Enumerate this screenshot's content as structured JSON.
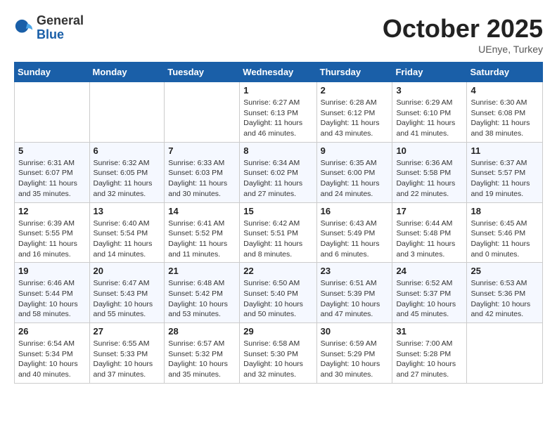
{
  "header": {
    "logo_general": "General",
    "logo_blue": "Blue",
    "month_title": "October 2025",
    "subtitle": "UEnye, Turkey"
  },
  "weekdays": [
    "Sunday",
    "Monday",
    "Tuesday",
    "Wednesday",
    "Thursday",
    "Friday",
    "Saturday"
  ],
  "weeks": [
    [
      {
        "day": "",
        "info": ""
      },
      {
        "day": "",
        "info": ""
      },
      {
        "day": "",
        "info": ""
      },
      {
        "day": "1",
        "info": "Sunrise: 6:27 AM\nSunset: 6:13 PM\nDaylight: 11 hours\nand 46 minutes."
      },
      {
        "day": "2",
        "info": "Sunrise: 6:28 AM\nSunset: 6:12 PM\nDaylight: 11 hours\nand 43 minutes."
      },
      {
        "day": "3",
        "info": "Sunrise: 6:29 AM\nSunset: 6:10 PM\nDaylight: 11 hours\nand 41 minutes."
      },
      {
        "day": "4",
        "info": "Sunrise: 6:30 AM\nSunset: 6:08 PM\nDaylight: 11 hours\nand 38 minutes."
      }
    ],
    [
      {
        "day": "5",
        "info": "Sunrise: 6:31 AM\nSunset: 6:07 PM\nDaylight: 11 hours\nand 35 minutes."
      },
      {
        "day": "6",
        "info": "Sunrise: 6:32 AM\nSunset: 6:05 PM\nDaylight: 11 hours\nand 32 minutes."
      },
      {
        "day": "7",
        "info": "Sunrise: 6:33 AM\nSunset: 6:03 PM\nDaylight: 11 hours\nand 30 minutes."
      },
      {
        "day": "8",
        "info": "Sunrise: 6:34 AM\nSunset: 6:02 PM\nDaylight: 11 hours\nand 27 minutes."
      },
      {
        "day": "9",
        "info": "Sunrise: 6:35 AM\nSunset: 6:00 PM\nDaylight: 11 hours\nand 24 minutes."
      },
      {
        "day": "10",
        "info": "Sunrise: 6:36 AM\nSunset: 5:58 PM\nDaylight: 11 hours\nand 22 minutes."
      },
      {
        "day": "11",
        "info": "Sunrise: 6:37 AM\nSunset: 5:57 PM\nDaylight: 11 hours\nand 19 minutes."
      }
    ],
    [
      {
        "day": "12",
        "info": "Sunrise: 6:39 AM\nSunset: 5:55 PM\nDaylight: 11 hours\nand 16 minutes."
      },
      {
        "day": "13",
        "info": "Sunrise: 6:40 AM\nSunset: 5:54 PM\nDaylight: 11 hours\nand 14 minutes."
      },
      {
        "day": "14",
        "info": "Sunrise: 6:41 AM\nSunset: 5:52 PM\nDaylight: 11 hours\nand 11 minutes."
      },
      {
        "day": "15",
        "info": "Sunrise: 6:42 AM\nSunset: 5:51 PM\nDaylight: 11 hours\nand 8 minutes."
      },
      {
        "day": "16",
        "info": "Sunrise: 6:43 AM\nSunset: 5:49 PM\nDaylight: 11 hours\nand 6 minutes."
      },
      {
        "day": "17",
        "info": "Sunrise: 6:44 AM\nSunset: 5:48 PM\nDaylight: 11 hours\nand 3 minutes."
      },
      {
        "day": "18",
        "info": "Sunrise: 6:45 AM\nSunset: 5:46 PM\nDaylight: 11 hours\nand 0 minutes."
      }
    ],
    [
      {
        "day": "19",
        "info": "Sunrise: 6:46 AM\nSunset: 5:44 PM\nDaylight: 10 hours\nand 58 minutes."
      },
      {
        "day": "20",
        "info": "Sunrise: 6:47 AM\nSunset: 5:43 PM\nDaylight: 10 hours\nand 55 minutes."
      },
      {
        "day": "21",
        "info": "Sunrise: 6:48 AM\nSunset: 5:42 PM\nDaylight: 10 hours\nand 53 minutes."
      },
      {
        "day": "22",
        "info": "Sunrise: 6:50 AM\nSunset: 5:40 PM\nDaylight: 10 hours\nand 50 minutes."
      },
      {
        "day": "23",
        "info": "Sunrise: 6:51 AM\nSunset: 5:39 PM\nDaylight: 10 hours\nand 47 minutes."
      },
      {
        "day": "24",
        "info": "Sunrise: 6:52 AM\nSunset: 5:37 PM\nDaylight: 10 hours\nand 45 minutes."
      },
      {
        "day": "25",
        "info": "Sunrise: 6:53 AM\nSunset: 5:36 PM\nDaylight: 10 hours\nand 42 minutes."
      }
    ],
    [
      {
        "day": "26",
        "info": "Sunrise: 6:54 AM\nSunset: 5:34 PM\nDaylight: 10 hours\nand 40 minutes."
      },
      {
        "day": "27",
        "info": "Sunrise: 6:55 AM\nSunset: 5:33 PM\nDaylight: 10 hours\nand 37 minutes."
      },
      {
        "day": "28",
        "info": "Sunrise: 6:57 AM\nSunset: 5:32 PM\nDaylight: 10 hours\nand 35 minutes."
      },
      {
        "day": "29",
        "info": "Sunrise: 6:58 AM\nSunset: 5:30 PM\nDaylight: 10 hours\nand 32 minutes."
      },
      {
        "day": "30",
        "info": "Sunrise: 6:59 AM\nSunset: 5:29 PM\nDaylight: 10 hours\nand 30 minutes."
      },
      {
        "day": "31",
        "info": "Sunrise: 7:00 AM\nSunset: 5:28 PM\nDaylight: 10 hours\nand 27 minutes."
      },
      {
        "day": "",
        "info": ""
      }
    ]
  ]
}
